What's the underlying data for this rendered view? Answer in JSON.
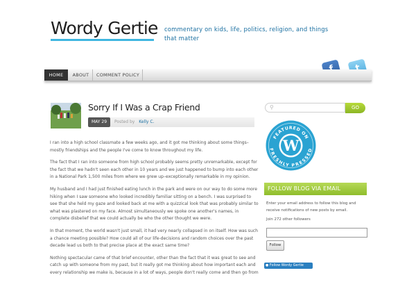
{
  "site": {
    "title": "Wordy Gertie",
    "tagline": "commentary on kids, life, politics, religion, and things that matter"
  },
  "nav": {
    "items": [
      {
        "label": "HOME",
        "active": true
      },
      {
        "label": "ABOUT",
        "active": false
      },
      {
        "label": "COMMENT POLICY",
        "active": false
      }
    ]
  },
  "social": {
    "facebook_icon": "facebook-icon",
    "twitter_icon": "twitter-icon"
  },
  "post": {
    "title": "Sorry If I Was a Crap Friend",
    "date": "MAY 29",
    "posted_by": "Posted by",
    "author": "Kelly C.",
    "paragraphs": [
      "I ran into a high school classmate a few weeks ago, and it got me thinking about some things–mostly friendships and the people I've come to know throughout my life.",
      "The fact that I ran into someone from high school probably seems pretty unremarkable, except for the fact that we hadn't seen each other in 10 years and we just happened to bump into each other in a National Park 1,500 miles from where we grew up–exceptionally remarkable in my opinion.",
      "My husband and I had just finished eating lunch in the park and were on our way to do some more hiking when I saw someone who looked incredibly familiar sitting on a bench. I was surprised to see that she held my gaze and looked back at me with a quizzical look that was probably similar to what was plastered on my face. Almost simultaneously we spoke one another's names, in complete disbelief that we could actually be who the other thought we were.",
      "In that moment, the world wasn't just small, it had very nearly collapsed in on itself. How was such a chance meeting possible? How could all of our life-decisions and random choices over the past decade lead us both to that precise place at the exact same time?",
      "Nothing spectacular came of that brief encounter, other than the fact that it was great to see and catch up with someone from my past, but it really got me thinking about how important each and every relationship we make is, because in a lot of ways, people don't really come and then go from"
    ]
  },
  "sidebar": {
    "search": {
      "placeholder": "",
      "button": "GO"
    },
    "badge": {
      "top_text": "FEATURED ON",
      "bottom_text": "FRESHLY PRESSED"
    },
    "follow": {
      "heading": "FOLLOW BLOG VIA EMAIL",
      "description": "Enter your email address to follow this blog and receive notifications of new posts by email.",
      "count": "Join 272 other followers",
      "button": "Follow",
      "widget": "Follow Wordy Gertie"
    }
  },
  "colors": {
    "accent_blue": "#3fb6e0",
    "link_blue": "#1a6fa1",
    "green": "#9cc83b",
    "nav_active": "#333333"
  }
}
